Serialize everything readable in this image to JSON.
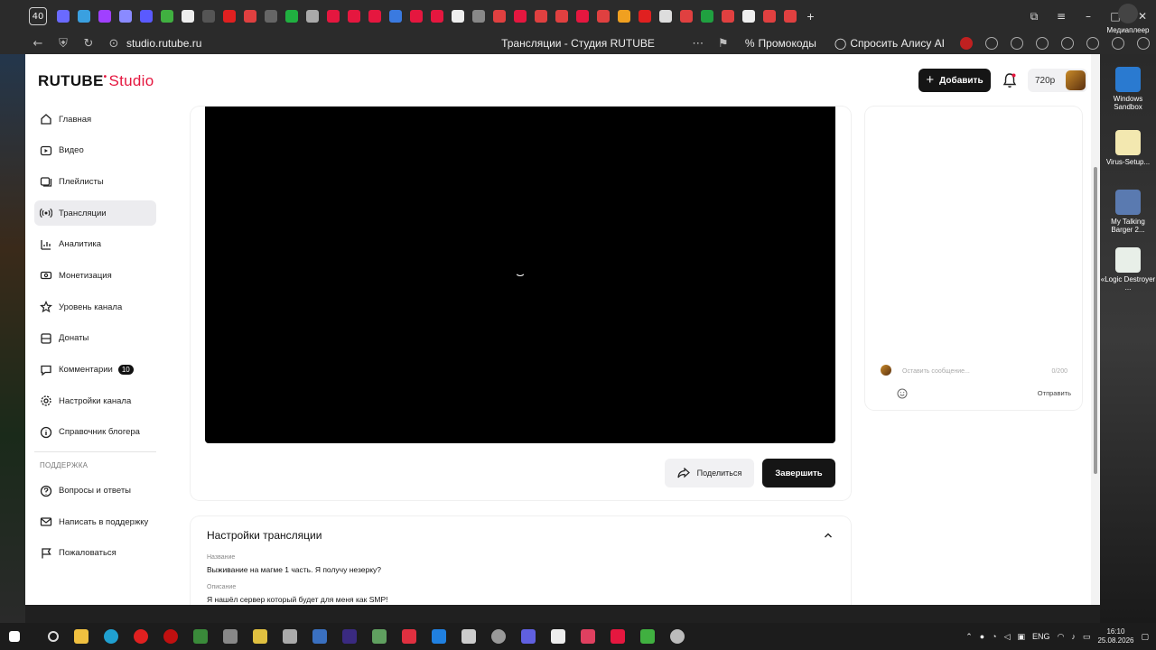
{
  "browser": {
    "tab_count": "40",
    "url": "studio.rutube.ru",
    "page_title": "Трансляции - Студия RUTUBE",
    "promo_label": "Промокоды",
    "alice_label": "Спросить Алису AI"
  },
  "header": {
    "logo_main": "RUTUBE",
    "logo_studio": "Studio",
    "add_label": "Добавить",
    "quality": "720p"
  },
  "sidebar": {
    "items": [
      {
        "label": "Главная",
        "icon": "home-icon"
      },
      {
        "label": "Видео",
        "icon": "video-icon"
      },
      {
        "label": "Плейлисты",
        "icon": "playlist-icon"
      },
      {
        "label": "Трансляции",
        "icon": "broadcast-icon"
      },
      {
        "label": "Аналитика",
        "icon": "analytics-icon"
      },
      {
        "label": "Монетизация",
        "icon": "money-icon"
      },
      {
        "label": "Уровень канала",
        "icon": "star-icon"
      },
      {
        "label": "Донаты",
        "icon": "donate-icon"
      },
      {
        "label": "Комментарии",
        "icon": "comment-icon",
        "badge": "10"
      },
      {
        "label": "Настройки канала",
        "icon": "gear-icon"
      },
      {
        "label": "Справочник блогера",
        "icon": "info-icon"
      }
    ],
    "support_label": "ПОДДЕРЖКА",
    "support_items": [
      {
        "label": "Вопросы и ответы",
        "icon": "question-icon"
      },
      {
        "label": "Написать в поддержку",
        "icon": "mail-icon"
      },
      {
        "label": "Пожаловаться",
        "icon": "flag-icon"
      }
    ]
  },
  "player": {
    "share_label": "Поделиться",
    "finish_label": "Завершить"
  },
  "chat": {
    "placeholder": "Оставить сообщение...",
    "counter": "0/200",
    "send_label": "Отправить"
  },
  "settings": {
    "title": "Настройки трансляции",
    "name_label": "Название",
    "name_value": "Выживание на магме 1 часть. Я получу незерку?",
    "desc_label": "Описание",
    "desc_value": "Я нашёл сервер который будет для меня как SMP!"
  },
  "desktop": {
    "icons": [
      {
        "label": "Медиаплеер"
      },
      {
        "label": "Windows Sandbox"
      },
      {
        "label": "Virus-Setup..."
      },
      {
        "label": "My Talking Barger 2..."
      },
      {
        "label": "«Logic Destroyer ..."
      }
    ]
  },
  "taskbar": {
    "lang": "ENG",
    "time": "16:10",
    "date": "25.08.2026"
  },
  "colors": {
    "accent": "#e5173f",
    "dark_button": "#151515",
    "active_nav": "#ececef"
  }
}
